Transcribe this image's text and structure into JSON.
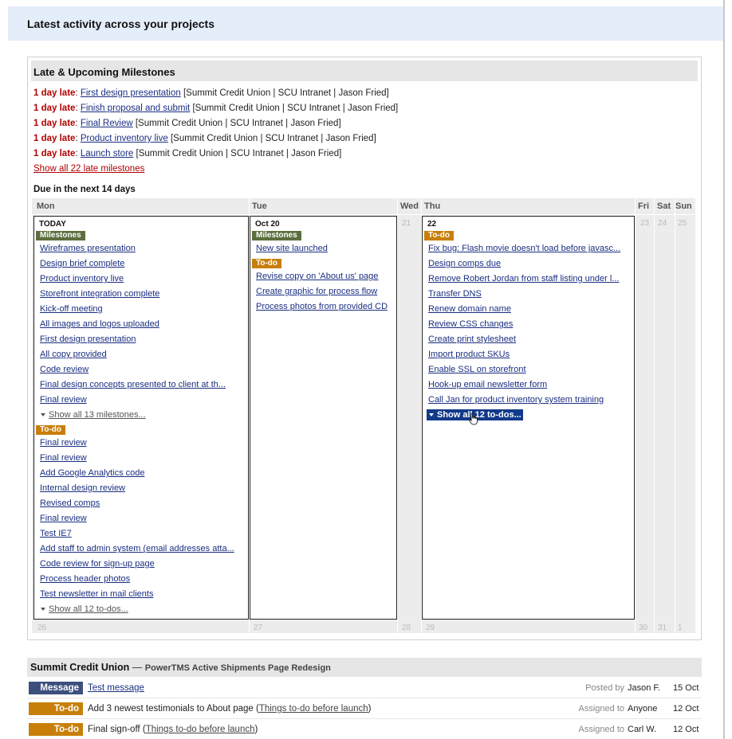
{
  "page_title": "Latest activity across your projects",
  "milestones_panel": {
    "title": "Late & Upcoming Milestones",
    "late_items": [
      {
        "status": "1 day late",
        "name": "First design presentation",
        "context": "[Summit Credit Union | SCU Intranet | Jason Fried]"
      },
      {
        "status": "1 day late",
        "name": "Finish proposal and submit",
        "context": "[Summit Credit Union | SCU Intranet | Jason Fried]"
      },
      {
        "status": "1 day late",
        "name": "Final Review",
        "context": "[Summit Credit Union | SCU Intranet | Jason Fried]"
      },
      {
        "status": "1 day late",
        "name": "Product inventory live",
        "context": "[Summit Credit Union | SCU Intranet | Jason Fried]"
      },
      {
        "status": "1 day late",
        "name": "Launch store",
        "context": "[Summit Credit Union | SCU Intranet | Jason Fried]"
      }
    ],
    "show_all_late": "Show all 22 late milestones",
    "due_title": "Due in the next 14 days"
  },
  "calendar": {
    "days": [
      "Mon",
      "Tue",
      "Wed",
      "Thu",
      "Fri",
      "Sat",
      "Sun"
    ],
    "mini_dates_top": {
      "wed": "21",
      "fri": "23",
      "sat": "24",
      "sun": "25"
    },
    "mini_dates_bottom": {
      "mon": "26",
      "tue": "27",
      "wed": "28",
      "thu": "29",
      "fri": "30",
      "sat": "31",
      "sun": "1"
    },
    "milestones_label": "Milestones",
    "todo_label": "To-do",
    "today": {
      "date": "TODAY",
      "milestones": [
        "Wireframes presentation",
        "Design brief complete",
        "Product inventory live",
        "Storefront integration complete",
        "Kick-off meeting",
        "All images and logos uploaded",
        "First design presentation",
        "All copy provided",
        "Code review",
        "Final design concepts presented to client at th...",
        "Final review"
      ],
      "milestones_more": "Show all 13 milestones...",
      "todos": [
        "Final review",
        "Final review",
        "Add Google Analytics code",
        "Internal design review",
        "Revised comps",
        "Final review",
        "Test IE7",
        "Add staff to admin system (email addresses atta...",
        "Code review for sign-up page",
        "Process header photos",
        "Test newsletter in mail clients"
      ],
      "todos_more": "Show all 12 to-dos..."
    },
    "oct20": {
      "date": "Oct 20",
      "milestones": [
        "New site launched"
      ],
      "todos": [
        "Revise copy on 'About us' page",
        "Create graphic for process flow",
        "Process photos from provided CD"
      ]
    },
    "thu22": {
      "date": "22",
      "todos": [
        "Fix bug: Flash movie doesn't load before javasc...",
        "Design comps due",
        "Remove Robert Jordan from staff listing under l...",
        "Transfer DNS",
        "Renew domain name",
        "Review CSS changes",
        "Create print stylesheet",
        "Import product SKUs",
        "Enable SSL on storefront",
        "Hook-up email newsletter form",
        "Call Jan for product inventory system training"
      ],
      "todos_more": "Show all 12 to-dos..."
    }
  },
  "project": {
    "name": "Summit Credit Union",
    "dash": "—",
    "subtitle": "PowerTMS Active Shipments Page Redesign",
    "activity": [
      {
        "type": "Message",
        "text": "Test message",
        "text_link": true,
        "list": "",
        "label": "Posted by",
        "person": "Jason F.",
        "date": "15 Oct"
      },
      {
        "type": "To-do",
        "text": "Add 3 newest testimonials to About page",
        "text_link": false,
        "list": "Things to-do before launch",
        "label": "Assigned to",
        "person": "Anyone",
        "date": "12 Oct"
      },
      {
        "type": "To-do",
        "text": "Final sign-off",
        "text_link": false,
        "list": "Things to-do before launch",
        "label": "Assigned to",
        "person": "Carl W.",
        "date": "12 Oct"
      }
    ]
  },
  "colors": {
    "late": "#b00000",
    "milestone_tag": "#5c6e3e",
    "todo_tag": "#c87f0a",
    "message_badge": "#3c4f7d",
    "highlight": "#123a8a"
  }
}
